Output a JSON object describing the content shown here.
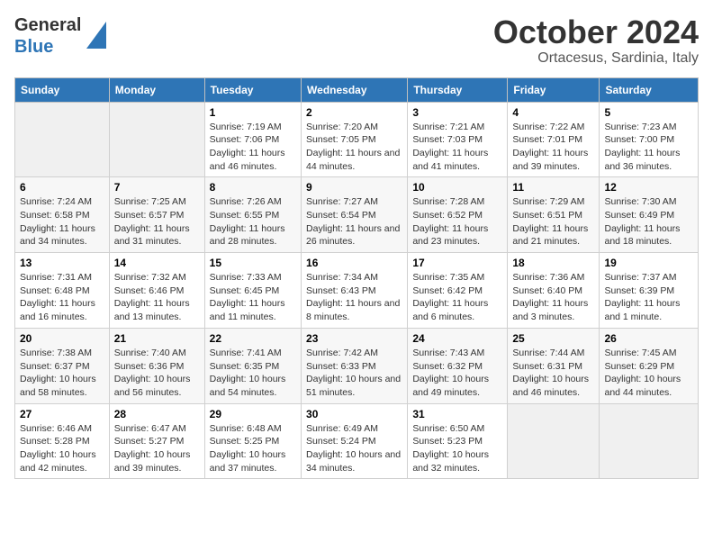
{
  "header": {
    "logo_general": "General",
    "logo_blue": "Blue",
    "title": "October 2024",
    "subtitle": "Ortacesus, Sardinia, Italy"
  },
  "days_of_week": [
    "Sunday",
    "Monday",
    "Tuesday",
    "Wednesday",
    "Thursday",
    "Friday",
    "Saturday"
  ],
  "weeks": [
    [
      {
        "day": "",
        "sunrise": "",
        "sunset": "",
        "daylight": ""
      },
      {
        "day": "",
        "sunrise": "",
        "sunset": "",
        "daylight": ""
      },
      {
        "day": "1",
        "sunrise": "Sunrise: 7:19 AM",
        "sunset": "Sunset: 7:06 PM",
        "daylight": "Daylight: 11 hours and 46 minutes."
      },
      {
        "day": "2",
        "sunrise": "Sunrise: 7:20 AM",
        "sunset": "Sunset: 7:05 PM",
        "daylight": "Daylight: 11 hours and 44 minutes."
      },
      {
        "day": "3",
        "sunrise": "Sunrise: 7:21 AM",
        "sunset": "Sunset: 7:03 PM",
        "daylight": "Daylight: 11 hours and 41 minutes."
      },
      {
        "day": "4",
        "sunrise": "Sunrise: 7:22 AM",
        "sunset": "Sunset: 7:01 PM",
        "daylight": "Daylight: 11 hours and 39 minutes."
      },
      {
        "day": "5",
        "sunrise": "Sunrise: 7:23 AM",
        "sunset": "Sunset: 7:00 PM",
        "daylight": "Daylight: 11 hours and 36 minutes."
      }
    ],
    [
      {
        "day": "6",
        "sunrise": "Sunrise: 7:24 AM",
        "sunset": "Sunset: 6:58 PM",
        "daylight": "Daylight: 11 hours and 34 minutes."
      },
      {
        "day": "7",
        "sunrise": "Sunrise: 7:25 AM",
        "sunset": "Sunset: 6:57 PM",
        "daylight": "Daylight: 11 hours and 31 minutes."
      },
      {
        "day": "8",
        "sunrise": "Sunrise: 7:26 AM",
        "sunset": "Sunset: 6:55 PM",
        "daylight": "Daylight: 11 hours and 28 minutes."
      },
      {
        "day": "9",
        "sunrise": "Sunrise: 7:27 AM",
        "sunset": "Sunset: 6:54 PM",
        "daylight": "Daylight: 11 hours and 26 minutes."
      },
      {
        "day": "10",
        "sunrise": "Sunrise: 7:28 AM",
        "sunset": "Sunset: 6:52 PM",
        "daylight": "Daylight: 11 hours and 23 minutes."
      },
      {
        "day": "11",
        "sunrise": "Sunrise: 7:29 AM",
        "sunset": "Sunset: 6:51 PM",
        "daylight": "Daylight: 11 hours and 21 minutes."
      },
      {
        "day": "12",
        "sunrise": "Sunrise: 7:30 AM",
        "sunset": "Sunset: 6:49 PM",
        "daylight": "Daylight: 11 hours and 18 minutes."
      }
    ],
    [
      {
        "day": "13",
        "sunrise": "Sunrise: 7:31 AM",
        "sunset": "Sunset: 6:48 PM",
        "daylight": "Daylight: 11 hours and 16 minutes."
      },
      {
        "day": "14",
        "sunrise": "Sunrise: 7:32 AM",
        "sunset": "Sunset: 6:46 PM",
        "daylight": "Daylight: 11 hours and 13 minutes."
      },
      {
        "day": "15",
        "sunrise": "Sunrise: 7:33 AM",
        "sunset": "Sunset: 6:45 PM",
        "daylight": "Daylight: 11 hours and 11 minutes."
      },
      {
        "day": "16",
        "sunrise": "Sunrise: 7:34 AM",
        "sunset": "Sunset: 6:43 PM",
        "daylight": "Daylight: 11 hours and 8 minutes."
      },
      {
        "day": "17",
        "sunrise": "Sunrise: 7:35 AM",
        "sunset": "Sunset: 6:42 PM",
        "daylight": "Daylight: 11 hours and 6 minutes."
      },
      {
        "day": "18",
        "sunrise": "Sunrise: 7:36 AM",
        "sunset": "Sunset: 6:40 PM",
        "daylight": "Daylight: 11 hours and 3 minutes."
      },
      {
        "day": "19",
        "sunrise": "Sunrise: 7:37 AM",
        "sunset": "Sunset: 6:39 PM",
        "daylight": "Daylight: 11 hours and 1 minute."
      }
    ],
    [
      {
        "day": "20",
        "sunrise": "Sunrise: 7:38 AM",
        "sunset": "Sunset: 6:37 PM",
        "daylight": "Daylight: 10 hours and 58 minutes."
      },
      {
        "day": "21",
        "sunrise": "Sunrise: 7:40 AM",
        "sunset": "Sunset: 6:36 PM",
        "daylight": "Daylight: 10 hours and 56 minutes."
      },
      {
        "day": "22",
        "sunrise": "Sunrise: 7:41 AM",
        "sunset": "Sunset: 6:35 PM",
        "daylight": "Daylight: 10 hours and 54 minutes."
      },
      {
        "day": "23",
        "sunrise": "Sunrise: 7:42 AM",
        "sunset": "Sunset: 6:33 PM",
        "daylight": "Daylight: 10 hours and 51 minutes."
      },
      {
        "day": "24",
        "sunrise": "Sunrise: 7:43 AM",
        "sunset": "Sunset: 6:32 PM",
        "daylight": "Daylight: 10 hours and 49 minutes."
      },
      {
        "day": "25",
        "sunrise": "Sunrise: 7:44 AM",
        "sunset": "Sunset: 6:31 PM",
        "daylight": "Daylight: 10 hours and 46 minutes."
      },
      {
        "day": "26",
        "sunrise": "Sunrise: 7:45 AM",
        "sunset": "Sunset: 6:29 PM",
        "daylight": "Daylight: 10 hours and 44 minutes."
      }
    ],
    [
      {
        "day": "27",
        "sunrise": "Sunrise: 6:46 AM",
        "sunset": "Sunset: 5:28 PM",
        "daylight": "Daylight: 10 hours and 42 minutes."
      },
      {
        "day": "28",
        "sunrise": "Sunrise: 6:47 AM",
        "sunset": "Sunset: 5:27 PM",
        "daylight": "Daylight: 10 hours and 39 minutes."
      },
      {
        "day": "29",
        "sunrise": "Sunrise: 6:48 AM",
        "sunset": "Sunset: 5:25 PM",
        "daylight": "Daylight: 10 hours and 37 minutes."
      },
      {
        "day": "30",
        "sunrise": "Sunrise: 6:49 AM",
        "sunset": "Sunset: 5:24 PM",
        "daylight": "Daylight: 10 hours and 34 minutes."
      },
      {
        "day": "31",
        "sunrise": "Sunrise: 6:50 AM",
        "sunset": "Sunset: 5:23 PM",
        "daylight": "Daylight: 10 hours and 32 minutes."
      },
      {
        "day": "",
        "sunrise": "",
        "sunset": "",
        "daylight": ""
      },
      {
        "day": "",
        "sunrise": "",
        "sunset": "",
        "daylight": ""
      }
    ]
  ]
}
